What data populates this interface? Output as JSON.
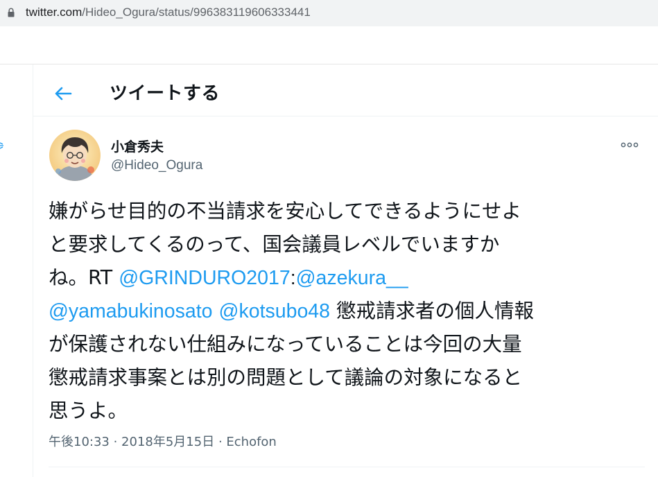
{
  "browser": {
    "url_domain": "twitter.com",
    "url_path": "/Hideo_Ogura/status/996383119606333441"
  },
  "header": {
    "title": "ツイートする"
  },
  "tweet": {
    "author_name": "小倉秀夫",
    "author_handle": "@Hideo_Ogura",
    "lines": [
      "嫌がらせ目的の不当請求を安心してできるようにせよ",
      "と要求してくるのって、国会議員レベルでいますか",
      "ね。RT "
    ],
    "mention_1": "@GRINDURO2017",
    "colon": ":",
    "mention_2": "@azekura__",
    "mention_3": "@yamabukinosato",
    "mention_4": "@kotsubo48",
    "line4_rest": " 懲戒請求者の個人情報",
    "lines_after": [
      "が保護されない仕組みになっていることは今回の大量",
      "懲戒請求事案とは別の問題として議論の対象になると",
      "思うよ。"
    ],
    "time": "午後10:33",
    "date": "2018年5月15日",
    "source": "Echofon",
    "separator": " · "
  },
  "colors": {
    "accent": "#1d9bf0",
    "secondary_text": "#536471",
    "primary_text": "#0f1419"
  },
  "icons": {
    "lock": "lock-icon",
    "back": "back-arrow-icon",
    "more": "more-icon"
  }
}
